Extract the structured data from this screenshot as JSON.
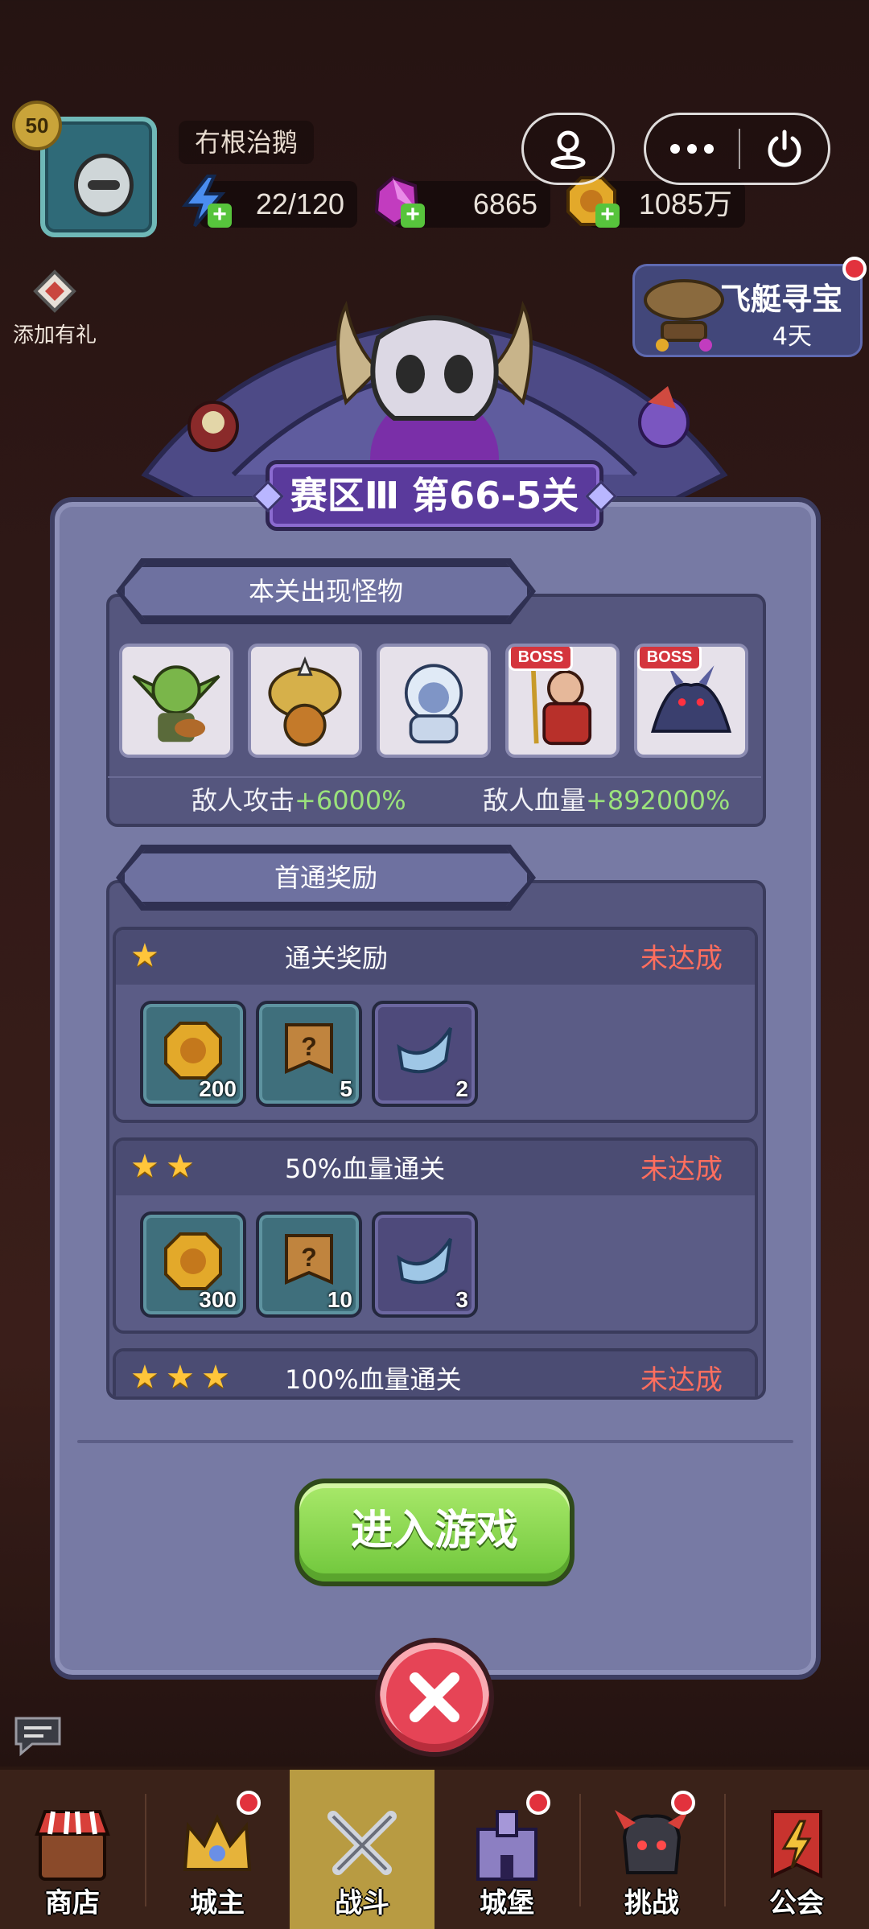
{
  "player": {
    "level": "50",
    "name": "冇根治鹅"
  },
  "resources": {
    "energy": "22/120",
    "gems": "6865",
    "gold": "1085万"
  },
  "side": {
    "add_gift": "添加有礼"
  },
  "airship": {
    "title": "飞艇寻宝",
    "sub": "4天"
  },
  "dialog": {
    "title": "赛区Ⅲ 第66-5关",
    "monsters_header": "本关出现怪物",
    "boss_label": "BOSS",
    "enemy_attack_label": "敌人攻击",
    "enemy_attack_value": "+6000%",
    "enemy_hp_label": "敌人血量",
    "enemy_hp_value": "+892000%",
    "rewards_header": "首通奖励",
    "rewards": [
      {
        "title": "通关奖励",
        "status": "未达成",
        "items": [
          "200",
          "5",
          "2"
        ]
      },
      {
        "title": "50%血量通关",
        "status": "未达成",
        "items": [
          "300",
          "10",
          "3"
        ]
      },
      {
        "title": "100%血量通关",
        "status": "未达成"
      }
    ],
    "enter_button": "进入游戏"
  },
  "nav": {
    "shop": "商店",
    "lord": "城主",
    "battle": "战斗",
    "castle": "城堡",
    "challenge": "挑战",
    "guild": "公会"
  },
  "colors": {
    "dialog": "#777aa4",
    "accent_green": "#9be27c",
    "status_red": "#ff6e5e",
    "nav_active": "#b89b42"
  }
}
